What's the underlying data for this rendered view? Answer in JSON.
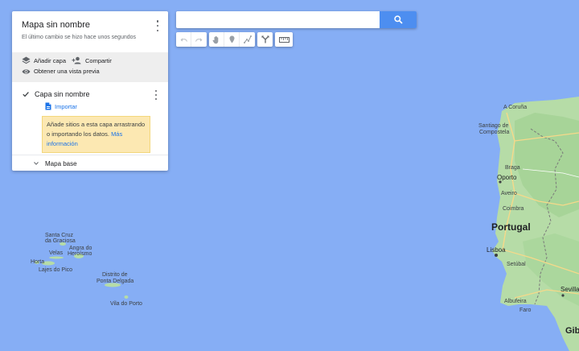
{
  "panel": {
    "title": "Mapa sin nombre",
    "subtitle": "El último cambio se hizo hace unos segundos",
    "actions": {
      "add_layer": "Añadir capa",
      "share": "Compartir",
      "preview": "Obtener una vista previa"
    },
    "layer": {
      "title": "Capa sin nombre",
      "import": "Importar",
      "hint_text": "Añade sitios a esta capa arrastrando o importando los datos.",
      "hint_link": "Más información"
    },
    "base_map": "Mapa base"
  },
  "search": {
    "value": "",
    "placeholder": ""
  },
  "toolbar": {
    "icons": [
      "undo-icon",
      "redo-icon",
      "hand-icon",
      "marker-icon",
      "line-icon",
      "directions-icon",
      "ruler-icon"
    ]
  },
  "map": {
    "labels": {
      "santa_cruz_1": "Santa Cruz",
      "santa_cruz_2": "da Graciosa",
      "angra_1": "Angra do",
      "angra_2": "Heroísmo",
      "velas": "Velas",
      "horta": "Horta",
      "lajes": "Lajes do Pico",
      "distrito_1": "Distrito de",
      "distrito_2": "Ponta Delgada",
      "vila": "Vila do Porto",
      "coruna": "A Coruña",
      "santiago_1": "Santiago de",
      "santiago_2": "Compostela",
      "braga": "Braga",
      "oporto": "Oporto",
      "aveiro": "Aveiro",
      "coimbra": "Coimbra",
      "leiria": "Leiria",
      "portugal": "Portugal",
      "lisboa": "Lisboa",
      "setubal": "Setúbal",
      "sevilla": "Sevilla",
      "albufeira": "Albufeira",
      "faro": "Faro",
      "gib": "Gib"
    },
    "colors": {
      "ocean": "#86aef5",
      "land": "#b6dca7",
      "land_dark": "#9ccf8e"
    }
  }
}
